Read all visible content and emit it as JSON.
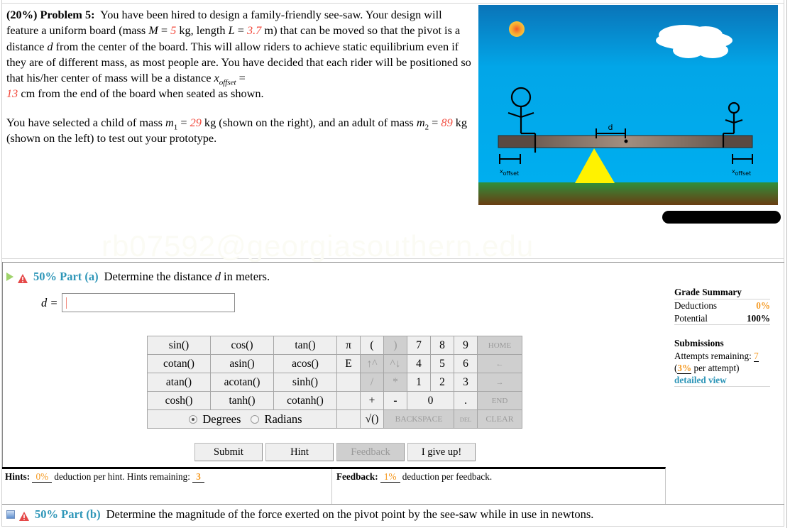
{
  "problem": {
    "weight": "(20%)",
    "label": "Problem 5:",
    "para1": {
      "t1": "You have been hired to design a family-friendly see-saw. Your design will feature a uniform board (mass ",
      "M_sym": "M",
      "t2": " = ",
      "M_val": "5",
      "t3": " kg, length ",
      "L_sym": "L",
      "t4": " = ",
      "L_val": "3.7",
      "t5": " m) that can be moved so that the pivot is a distance ",
      "d_sym": "d",
      "t6": " from the center of the board. This will allow riders to achieve static equilibrium even if they are of different mass, as most people are. You have decided that each rider will be positioned so that his/her center of mass will be a distance ",
      "x_sym": "x",
      "x_sub": "offset",
      "t7": " = ",
      "x_val": "13",
      "t8": " cm from the end of the board when seated as shown."
    },
    "para2": {
      "t1": "You have selected a child of mass ",
      "m1_sym": "m",
      "m1_sub": "1",
      "t2": " = ",
      "m1_val": "29",
      "t3": " kg (shown on the right), and an adult of mass ",
      "m2_sym": "m",
      "m2_sub": "2",
      "t4": " = ",
      "m2_val": "89",
      "t5": " kg (shown on the left) to test out your prototype."
    },
    "watermark": "rb07592@georgiasouthern.edu"
  },
  "figure": {
    "d_label": "d",
    "xoffset_left": "x",
    "xoffset_left_sub": "offset",
    "xoffset_right": "x",
    "xoffset_right_sub": "offset"
  },
  "part_a": {
    "weight": "50% Part (a)",
    "question_t1": "Determine the distance ",
    "question_var": "d",
    "question_t2": " in meters.",
    "answer_label": "d =",
    "answer_value": ""
  },
  "keypad": {
    "functions": [
      [
        "sin()",
        "cos()",
        "tan()"
      ],
      [
        "cotan()",
        "asin()",
        "acos()"
      ],
      [
        "atan()",
        "acotan()",
        "sinh()"
      ],
      [
        "cosh()",
        "tanh()",
        "cotanh()"
      ]
    ],
    "angle_mode": {
      "degrees": "Degrees",
      "radians": "Radians",
      "selected": "Degrees"
    },
    "symbols": {
      "pi": "π",
      "e": "E",
      "lparen": "(",
      "rparen": ")",
      "up": "↑^",
      "down": "^↓",
      "div": "/",
      "mul": "*",
      "plus": "+",
      "minus": "-",
      "sqrt": "√()",
      "dot": "."
    },
    "digits": [
      "7",
      "8",
      "9",
      "4",
      "5",
      "6",
      "1",
      "2",
      "3",
      "0"
    ],
    "nav": {
      "home": "HOME",
      "left": "←",
      "right": "→",
      "end": "END",
      "backspace": "BACKSPACE",
      "del": "DEL",
      "clear": "CLEAR"
    }
  },
  "actions": {
    "submit": "Submit",
    "hint": "Hint",
    "feedback": "Feedback",
    "give_up": "I give up!"
  },
  "hints": {
    "label": "Hints:",
    "deduction": "0%",
    "t1": "deduction per hint. Hints remaining:",
    "remaining": "3"
  },
  "feedback": {
    "label": "Feedback:",
    "deduction": "1%",
    "t1": "deduction per feedback."
  },
  "grade_summary": {
    "title": "Grade Summary",
    "deductions_label": "Deductions",
    "deductions_value": "0%",
    "potential_label": "Potential",
    "potential_value": "100%",
    "submissions_title": "Submissions",
    "attempts_label": "Attempts remaining:",
    "attempts_value": "7",
    "per_attempt_open": "(",
    "per_attempt_value": "3%",
    "per_attempt_text": " per attempt)",
    "detailed_view": "detailed view"
  },
  "part_b": {
    "weight": "50% Part (b)",
    "question": "Determine the magnitude of the force exerted on the pivot point by the see-saw while in use in newtons."
  }
}
